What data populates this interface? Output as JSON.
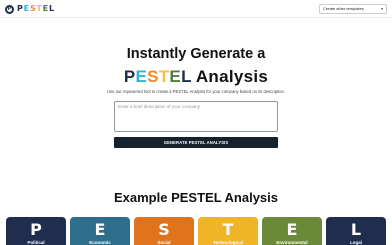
{
  "header": {
    "logo": {
      "mark_letter": "P",
      "segments": [
        {
          "text": "P",
          "color": "#1f2d4e"
        },
        {
          "text": "E",
          "color": "#2bb3d8"
        },
        {
          "text": "S",
          "color": "#f08a24"
        },
        {
          "text": "T",
          "color": "#f6c23e"
        },
        {
          "text": "E",
          "color": "#4e7d3a"
        },
        {
          "text": "L",
          "color": "#1f2d4e"
        }
      ]
    },
    "templates_dropdown": {
      "label": "Create other templates",
      "icon": "chevron-down-icon"
    }
  },
  "hero": {
    "line1": "Instantly Generate a",
    "line2_segments": [
      {
        "text": "P",
        "color": "#1f2d4e"
      },
      {
        "text": "E",
        "color": "#2bb3d8"
      },
      {
        "text": "S",
        "color": "#f08a24"
      },
      {
        "text": "T",
        "color": "#f6c23e"
      },
      {
        "text": "E",
        "color": "#4e7d3a"
      },
      {
        "text": "L",
        "color": "#1f2d4e"
      },
      {
        "text": " Analysis",
        "color": "#111111"
      }
    ],
    "subline": "Use our AIpowered tool to create a PESTEL Analysis for your company based on its description."
  },
  "form": {
    "placeholder": "Enter a brief description of your company",
    "value": "",
    "button_label": "GENERATE PESTEL ANALYSIS"
  },
  "example": {
    "title": "Example PESTEL Analysis",
    "cards": [
      {
        "letter": "P",
        "label": "Political",
        "color": "#1f2d4e"
      },
      {
        "letter": "E",
        "label": "Economic",
        "color": "#2e6e8c"
      },
      {
        "letter": "S",
        "label": "Social",
        "color": "#e0741c"
      },
      {
        "letter": "T",
        "label": "Technological",
        "color": "#f0b429"
      },
      {
        "letter": "E",
        "label": "Environmental",
        "color": "#6a8a3a"
      },
      {
        "letter": "L",
        "label": "Legal",
        "color": "#1f2d4e"
      }
    ]
  }
}
